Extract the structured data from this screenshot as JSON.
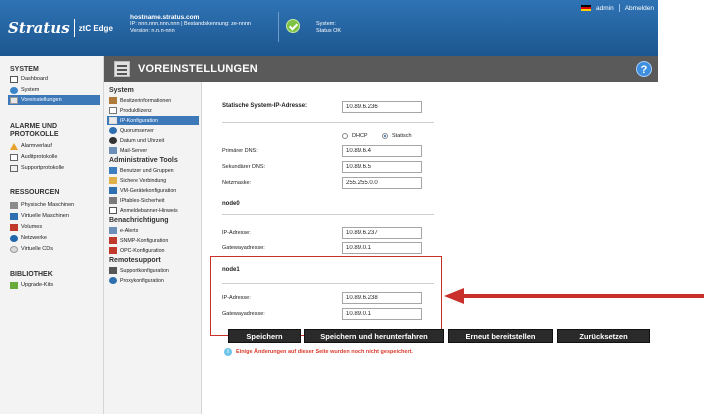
{
  "banner": {
    "brand": "Stratus",
    "product": "ztC Edge",
    "hostname": "hostname.stratus.com",
    "ip_line": "IP: nnn.nnn.nnn.nnn | Bestandskennung: ze-nnnn",
    "version": "Version: n.n.n-nnn",
    "system_label": "System:",
    "system_status": "Status OK",
    "user": "admin",
    "logout": "Abmelden"
  },
  "leftnav": {
    "sections": [
      {
        "title": "SYSTEM",
        "items": [
          "Dashboard",
          "System",
          "Voreinstellungen"
        ]
      },
      {
        "title": "ALARME UND PROTOKOLLE",
        "items": [
          "Alarmverlauf",
          "Auditprotokolle",
          "Supportprotokolle"
        ]
      },
      {
        "title": "RESSOURCEN",
        "items": [
          "Physische Maschinen",
          "Virtuelle Maschinen",
          "Volumes",
          "Netzwerke",
          "Virtuelle CDs"
        ]
      },
      {
        "title": "BIBLIOTHEK",
        "items": [
          "Upgrade-Kits"
        ]
      }
    ],
    "active": "Voreinstellungen"
  },
  "header": {
    "title": "VOREINSTELLUNGEN",
    "help": "?"
  },
  "subnav": {
    "sections": [
      {
        "title": "System",
        "items": [
          "Besitzerinformationen",
          "Produktlizenz",
          "IP-Konfiguration",
          "Quorumserver",
          "Datum und Uhrzeit",
          "Mail-Server"
        ]
      },
      {
        "title": "Administrative Tools",
        "items": [
          "Benutzer und Gruppen",
          "Sichere Verbindung",
          "VM-Gerätekonfiguration",
          "IPtables-Sicherheit",
          "Anmeldebanner-Hinweis"
        ]
      },
      {
        "title": "Benachrichtigung",
        "items": [
          "e-Alerts",
          "SNMP-Konfiguration",
          "OPC-Konfiguration"
        ]
      },
      {
        "title": "Remotesupport",
        "items": [
          "Supportkonfiguration",
          "Proxykonfiguration"
        ]
      }
    ],
    "active": "IP-Konfiguration"
  },
  "form": {
    "static_ip_label": "Statische System-IP-Adresse:",
    "static_ip_value": "10.89.6.236",
    "dhcp_label": "DHCP",
    "static_label": "Statisch",
    "dns1_label": "Primärer DNS:",
    "dns1_value": "10.89.6.4",
    "dns2_label": "Sekundärer DNS:",
    "dns2_value": "10.89.6.5",
    "netmask_label": "Netzmaske:",
    "netmask_value": "255.255.0.0",
    "node0_title": "node0",
    "node0_ip_label": "IP-Adresse:",
    "node0_ip_value": "10.89.6.237",
    "node0_gw_label": "Gatewayadresse:",
    "node0_gw_value": "10.89.0.1",
    "node1_title": "node1",
    "node1_ip_label": "IP-Adresse:",
    "node1_ip_value": "10.89.6.238",
    "node1_gw_label": "Gatewayadresse:",
    "node1_gw_value": "10.89.0.1"
  },
  "buttons": {
    "save": "Speichern",
    "save_shutdown": "Speichern und herunterfahren",
    "redeploy": "Erneut bereitstellen",
    "reset": "Zurücksetzen"
  },
  "warning": "Einige Änderungen auf dieser Seite wurden noch nicht gespeichert.",
  "colors": {
    "banner": "#1f5c99",
    "highlight": "#c9302c",
    "accent": "#3d78b8",
    "ok": "#7dc243"
  }
}
